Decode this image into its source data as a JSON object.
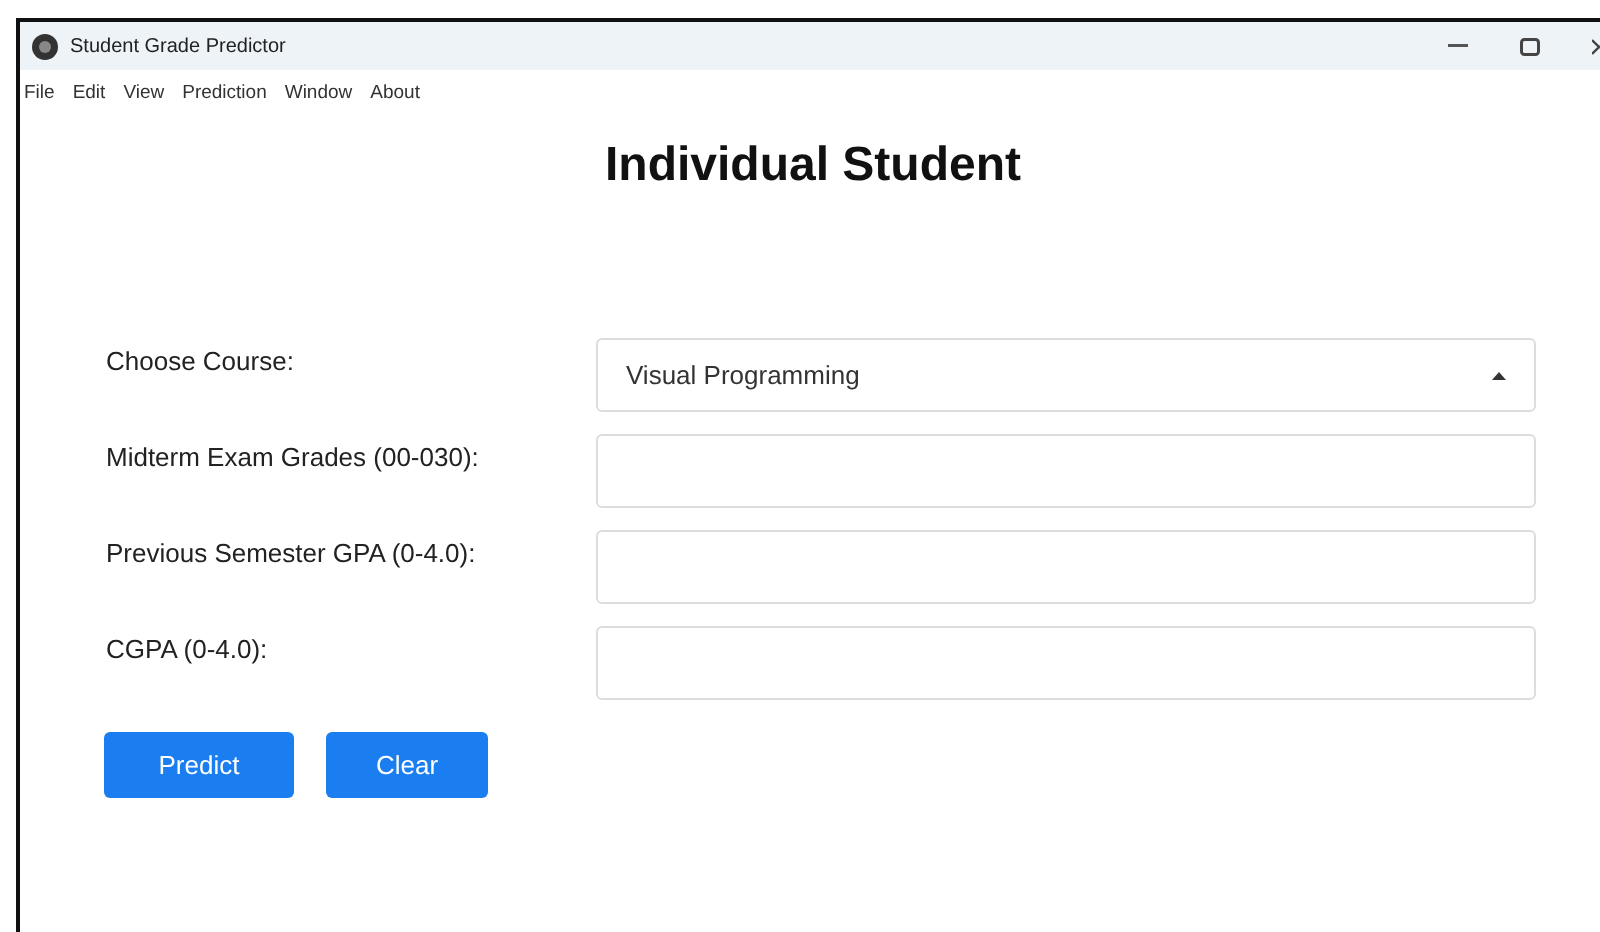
{
  "window": {
    "title": "Student Grade Predictor"
  },
  "menu": [
    "File",
    "Edit",
    "View",
    "Prediction",
    "Window",
    "About"
  ],
  "heading": "Individual Student",
  "form": [
    {
      "kind": "select",
      "label": "Choose Course:",
      "value": "Visual Programming"
    },
    {
      "kind": "input",
      "label": "Midterm Exam Grades (00-030):"
    },
    {
      "kind": "input",
      "label": "Previous Semester GPA (0-4.0):"
    },
    {
      "kind": "input",
      "label": "CGPA (0-4.0):"
    }
  ],
  "buttons": [
    "Predict",
    "Clear"
  ]
}
